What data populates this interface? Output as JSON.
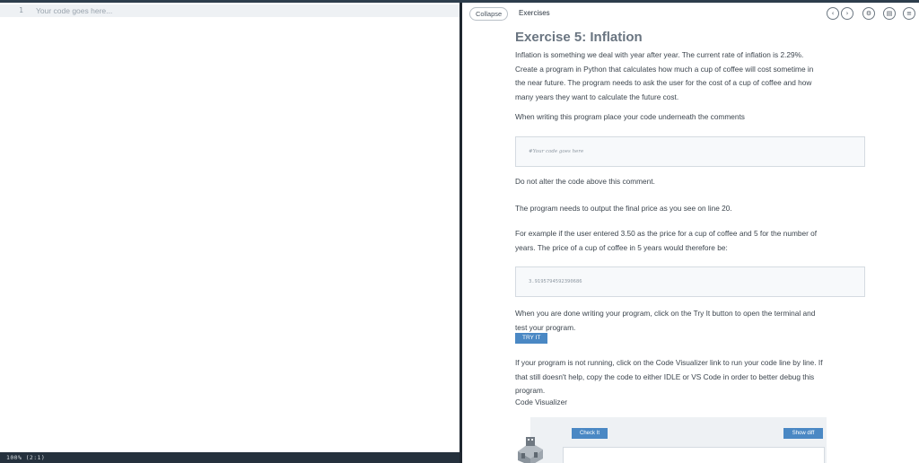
{
  "editor": {
    "line_number": "1",
    "placeholder": "Your code goes here...",
    "status": "100% (2:1)"
  },
  "guide": {
    "collapse_label": "Collapse",
    "title": "Exercises",
    "header_buttons": [
      "prev-icon",
      "next-icon",
      "gear-icon",
      "book-icon",
      "menu-icon"
    ]
  },
  "exercise": {
    "title": "Exercise 5: Inflation",
    "intro_lines": [
      "Inflation is something we deal with year after year. The current rate of inflation is 2.29%.",
      "Create a program in Python that calculates how much a cup of coffee will cost sometime in",
      "the near future. The program needs to ask the user for the cost of a cup of coffee and how",
      "many years they want to calculate the future cost."
    ],
    "instruction": "When writing this program place your code underneath the comments",
    "code_comment": "#Your code goes here",
    "no_alter": "Do not alter the code above this comment.",
    "output_note": "The program needs to output the final price as you see on line 20.",
    "example_lines": [
      "For example if the user entered 3.50 as the price for a cup of coffee and 5 for the number of",
      "years. The price of a cup of coffee in 5 years would therefore be:"
    ],
    "example_output": "3.9195794592390686",
    "done_lines": [
      "When you are done writing your program, click on the Try It button to open the terminal and",
      "test your program."
    ],
    "try_it_label": "TRY IT",
    "debug_lines": [
      "If your program is not running, click on the Code Visualizer link to run your code line by line. If",
      "that still doesn't help, copy the code to either IDLE or VS Code in order to better debug this",
      "program."
    ],
    "code_visualizer": "Code Visualizer",
    "check_it_label": "Check It",
    "show_diff_label": "Show diff"
  }
}
